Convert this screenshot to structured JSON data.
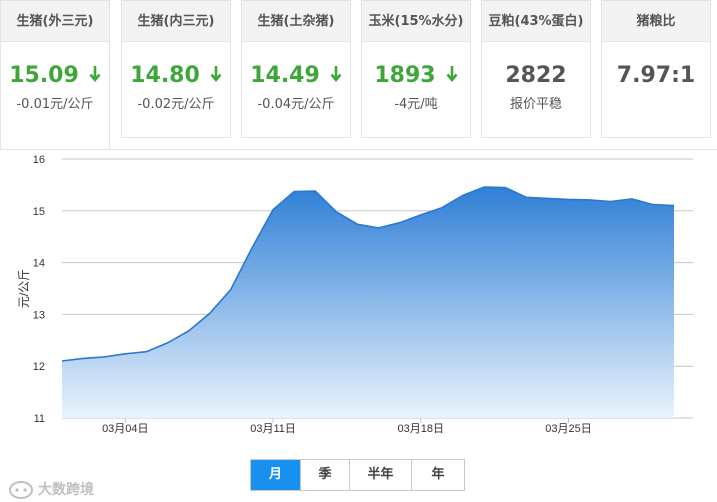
{
  "cards": [
    {
      "title": "生猪(外三元)",
      "value": "15.09",
      "change": "-0.01元/公斤",
      "trend": "down"
    },
    {
      "title": "生猪(内三元)",
      "value": "14.80",
      "change": "-0.02元/公斤",
      "trend": "down"
    },
    {
      "title": "生猪(土杂猪)",
      "value": "14.49",
      "change": "-0.04元/公斤",
      "trend": "down"
    },
    {
      "title": "玉米(15%水分)",
      "value": "1893",
      "change": "-4元/吨",
      "trend": "down"
    },
    {
      "title": "豆粕(43%蛋白)",
      "value": "2822",
      "change": "报价平稳",
      "trend": "flat"
    },
    {
      "title": "猪粮比",
      "value": "7.97:1",
      "change": "",
      "trend": "none"
    }
  ],
  "colors": {
    "down": "#3ea73a",
    "accent": "#1890f0",
    "area_top": "#2f7fd6",
    "area_bottom": "#eaf3fc"
  },
  "chart_data": {
    "type": "area",
    "ylabel": "元/公斤",
    "ylim": [
      11,
      16
    ],
    "yticks": [
      11,
      12,
      13,
      14,
      15,
      16
    ],
    "xlim": [
      1,
      30.9
    ],
    "xticks": [
      {
        "x": 4,
        "label": "03月04日"
      },
      {
        "x": 11,
        "label": "03月11日"
      },
      {
        "x": 18,
        "label": "03月18日"
      },
      {
        "x": 25,
        "label": "03月25日"
      }
    ],
    "grid": true,
    "series": [
      {
        "x": [
          1,
          2,
          3,
          4,
          5,
          6,
          7,
          8,
          9,
          10,
          11,
          12,
          13,
          14,
          15,
          16,
          17,
          18,
          19,
          20,
          21,
          22,
          23,
          24,
          25,
          26,
          27,
          28,
          29,
          30
        ],
        "values": [
          12.1,
          12.15,
          12.18,
          12.24,
          12.28,
          12.45,
          12.68,
          13.02,
          13.48,
          14.28,
          15.02,
          15.37,
          15.38,
          14.98,
          14.74,
          14.67,
          14.77,
          14.92,
          15.06,
          15.3,
          15.46,
          15.45,
          15.26,
          15.24,
          15.22,
          15.21,
          15.18,
          15.23,
          15.12,
          15.1
        ]
      }
    ]
  },
  "tabs": [
    {
      "label": "月",
      "active": true
    },
    {
      "label": "季",
      "active": false
    },
    {
      "label": "半年",
      "active": false
    },
    {
      "label": "年",
      "active": false
    }
  ],
  "watermark": {
    "text": "大数跨境"
  }
}
